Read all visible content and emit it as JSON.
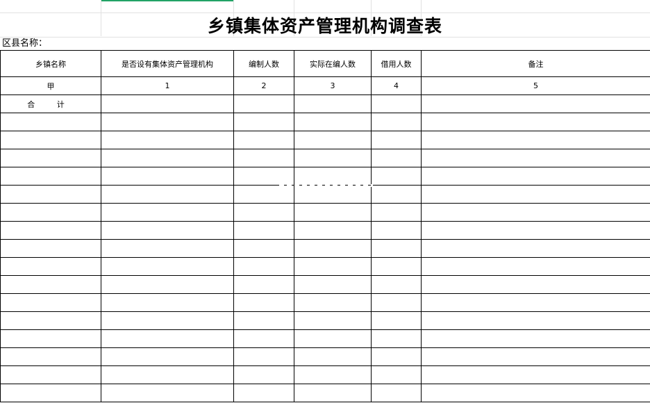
{
  "title": "乡镇集体资产管理机构调查表",
  "county_label": "区县名称：",
  "table": {
    "headers": [
      "乡镇名称",
      "是否设有集体资产管理机构",
      "编制人数",
      "实际在编人数",
      "借用人数",
      "备注"
    ],
    "column_numbers": [
      "甲",
      "1",
      "2",
      "3",
      "4",
      "5"
    ],
    "total_label": "合   计",
    "empty_row_count": 16
  }
}
